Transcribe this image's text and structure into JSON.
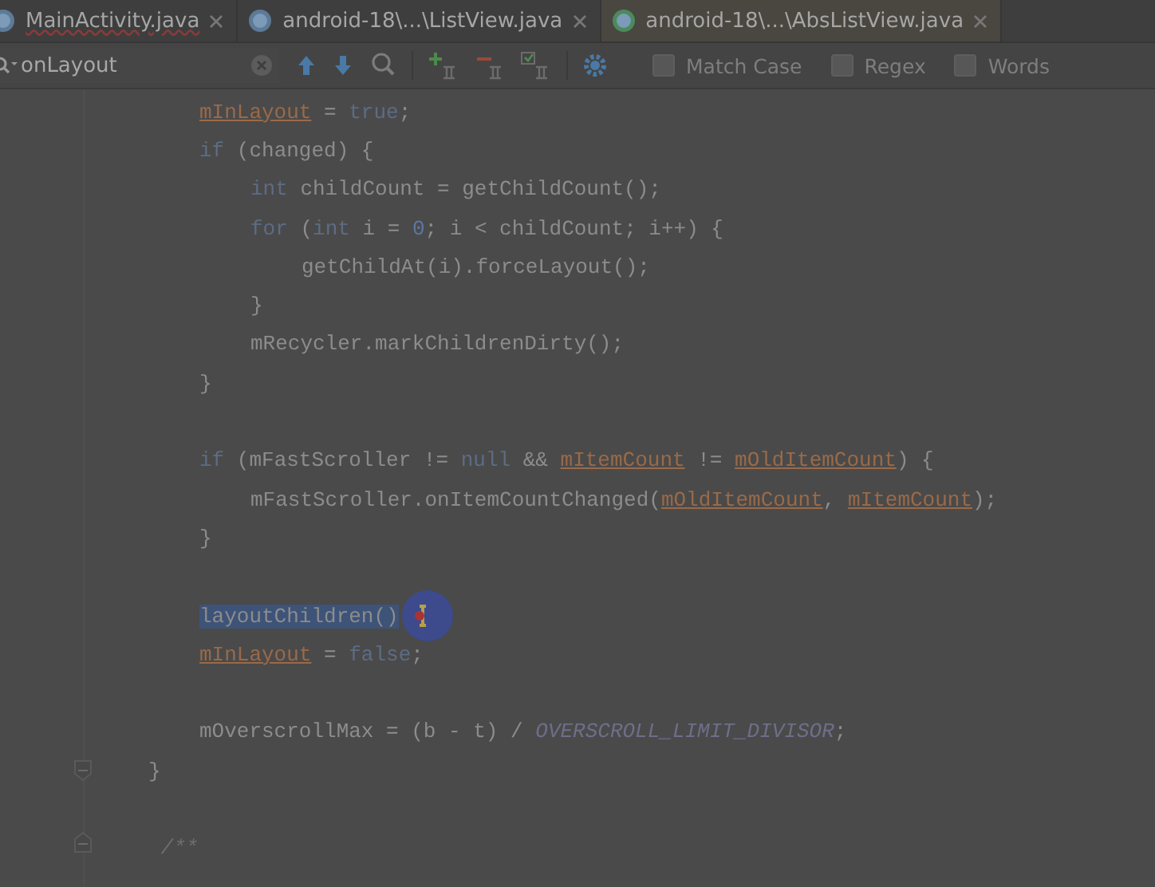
{
  "tabs": [
    {
      "label": "MainActivity.java",
      "selected": false,
      "error": true
    },
    {
      "label": "android-18\\...\\ListView.java",
      "selected": false,
      "error": false
    },
    {
      "label": "android-18\\...\\AbsListView.java",
      "selected": true,
      "error": false
    }
  ],
  "search": {
    "value": "onLayout",
    "options": [
      {
        "label": "Match Case",
        "checked": false
      },
      {
        "label": "Regex",
        "checked": false
      },
      {
        "label": "Words",
        "checked": false
      }
    ]
  },
  "code": [
    {
      "kind": "group",
      "children": [
        {
          "kind": "code",
          "tokens": [
            {
              "kind": "field",
              "text": "mInLayout"
            },
            {
              "kind": "plain",
              "text": " = "
            },
            {
              "kind": "keyword",
              "text": "true"
            },
            {
              "kind": "plain",
              "text": ";"
            }
          ]
        },
        {
          "kind": "code",
          "tokens": [
            {
              "kind": "keyword",
              "text": "if"
            },
            {
              "kind": "plain",
              "text": " (changed) {"
            }
          ],
          "children": [
            {
              "kind": "code",
              "tokens": [
                {
                  "kind": "keyword",
                  "text": "int"
                },
                {
                  "kind": "plain",
                  "text": " childCount = getChildCount();"
                }
              ]
            },
            {
              "kind": "code",
              "tokens": [
                {
                  "kind": "keyword",
                  "text": "for"
                },
                {
                  "kind": "plain",
                  "text": " ("
                },
                {
                  "kind": "keyword",
                  "text": "int"
                },
                {
                  "kind": "plain",
                  "text": " i = "
                },
                {
                  "kind": "number",
                  "text": "0"
                },
                {
                  "kind": "plain",
                  "text": "; i < childCount; i++) {"
                }
              ],
              "children": [
                {
                  "kind": "code",
                  "tokens": [
                    {
                      "kind": "plain",
                      "text": "getChildAt(i).forceLayout();"
                    }
                  ]
                }
              ]
            },
            {
              "kind": "code",
              "tokens": [
                {
                  "kind": "plain",
                  "text": "}"
                }
              ]
            },
            {
              "kind": "code",
              "tokens": [
                {
                  "kind": "plain",
                  "text": "mRecycler.markChildrenDirty();"
                }
              ]
            }
          ]
        },
        {
          "kind": "code",
          "tokens": [
            {
              "kind": "plain",
              "text": "}"
            }
          ]
        },
        {
          "kind": "blank"
        },
        {
          "kind": "code",
          "tokens": [
            {
              "kind": "keyword",
              "text": "if"
            },
            {
              "kind": "plain",
              "text": " (mFastScroller != "
            },
            {
              "kind": "keyword",
              "text": "null"
            },
            {
              "kind": "plain",
              "text": " && "
            },
            {
              "kind": "field",
              "text": "mItemCount"
            },
            {
              "kind": "plain",
              "text": " != "
            },
            {
              "kind": "field",
              "text": "mOldItemCount"
            },
            {
              "kind": "plain",
              "text": ") {"
            }
          ],
          "children": [
            {
              "kind": "code",
              "tokens": [
                {
                  "kind": "plain",
                  "text": "mFastScroller.onItemCountChanged("
                },
                {
                  "kind": "field",
                  "text": "mOldItemCount"
                },
                {
                  "kind": "plain",
                  "text": ", "
                },
                {
                  "kind": "field",
                  "text": "mItemCount"
                },
                {
                  "kind": "plain",
                  "text": ");"
                }
              ]
            }
          ]
        },
        {
          "kind": "code",
          "tokens": [
            {
              "kind": "plain",
              "text": "}"
            }
          ]
        },
        {
          "kind": "blank"
        },
        {
          "kind": "code",
          "cursor": true,
          "tokens": [
            {
              "kind": "selected",
              "text": "layoutChildren()"
            }
          ]
        },
        {
          "kind": "code",
          "tokens": [
            {
              "kind": "field",
              "text": "mInLayout"
            },
            {
              "kind": "plain",
              "text": " = "
            },
            {
              "kind": "keyword",
              "text": "false"
            },
            {
              "kind": "plain",
              "text": ";"
            }
          ]
        },
        {
          "kind": "blank"
        },
        {
          "kind": "code",
          "tokens": [
            {
              "kind": "plain",
              "text": "mOverscrollMax = (b - t) / "
            },
            {
              "kind": "constant",
              "text": "OVERSCROLL_LIMIT_DIVISOR"
            },
            {
              "kind": "plain",
              "text": ";"
            }
          ]
        }
      ]
    },
    {
      "kind": "code",
      "tokens": [
        {
          "kind": "plain",
          "text": "}"
        }
      ]
    },
    {
      "kind": "blank"
    },
    {
      "kind": "code",
      "tokens": [
        {
          "kind": "comment",
          "text": " /**"
        }
      ]
    }
  ]
}
